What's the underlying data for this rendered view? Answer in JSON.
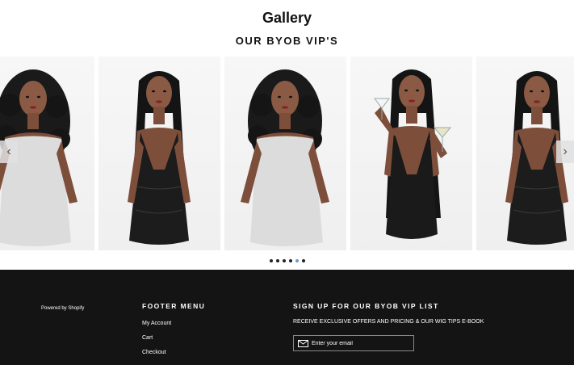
{
  "header": {
    "title": "Gallery",
    "subtitle": "OUR BYOB VIP'S"
  },
  "slider": {
    "slides": [
      {
        "dress": "white"
      },
      {
        "dress": "black-sequin"
      },
      {
        "dress": "white"
      },
      {
        "dress": "black-sequin"
      },
      {
        "dress": "black-sequin"
      }
    ],
    "prev_icon": "chevron-left-icon",
    "next_icon": "chevron-right-icon",
    "prev_glyph": "‹",
    "next_glyph": "›",
    "dots_count": 6,
    "active_dot": 4
  },
  "footer": {
    "powered_by": "Powered by Shopify",
    "menu_heading": "FOOTER MENU",
    "menu_items": [
      "My Account",
      "Cart",
      "Checkout"
    ],
    "signup_heading": "SIGN UP FOR OUR BYOB VIP LIST",
    "signup_description": "RECEIVE EXCLUSIVE OFFERS AND PRICING & OUR WIG TIPS E-BOOK",
    "email_placeholder": "Enter your email",
    "email_icon": "envelope-icon"
  },
  "colors": {
    "footer_bg": "#141414",
    "active_dot": "#6a9bd1",
    "text_dark": "#111111"
  }
}
